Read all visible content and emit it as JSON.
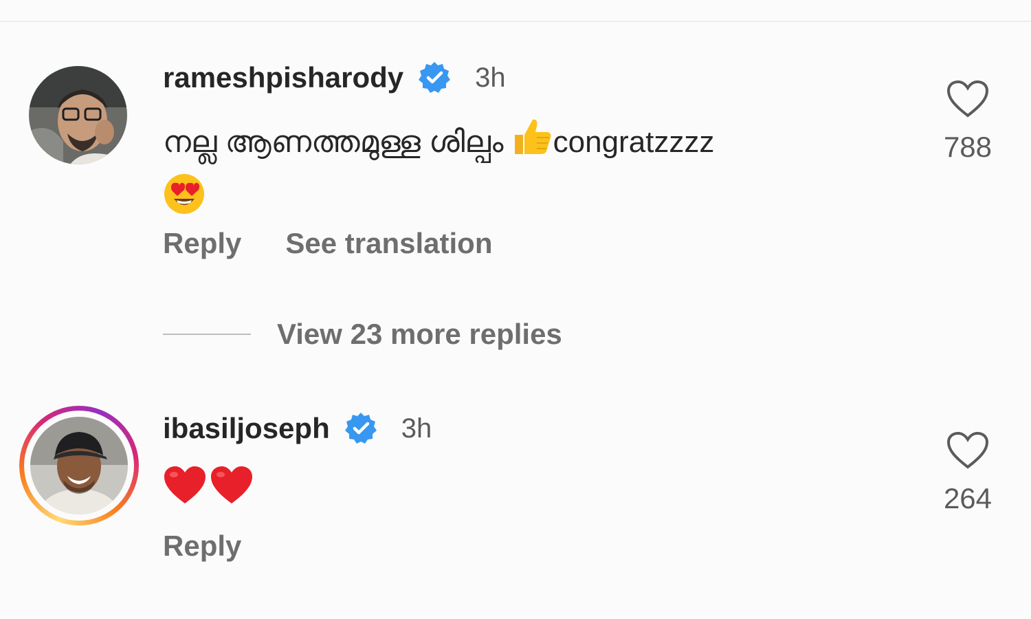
{
  "comments": [
    {
      "username": "rameshpisharody",
      "time": "3h",
      "text": "നല്ല ആണത്തമുള്ള ശില്പം",
      "text_suffix": "congratzzzz",
      "reply_label": "Reply",
      "translation_label": "See translation",
      "likes": "788"
    },
    {
      "username": "ibasiljoseph",
      "time": "3h",
      "reply_label": "Reply",
      "likes": "264"
    }
  ],
  "replies": {
    "label": "View 23 more replies"
  },
  "colors": {
    "verified": "#3897f0",
    "text": "#262626",
    "secondary": "#6e6e6e",
    "heart_emoji": "#e8202a"
  },
  "icons": [
    "verified-badge-icon",
    "like-heart-icon",
    "thumbs-up-emoji",
    "heart-eyes-emoji",
    "red-heart-emoji"
  ]
}
